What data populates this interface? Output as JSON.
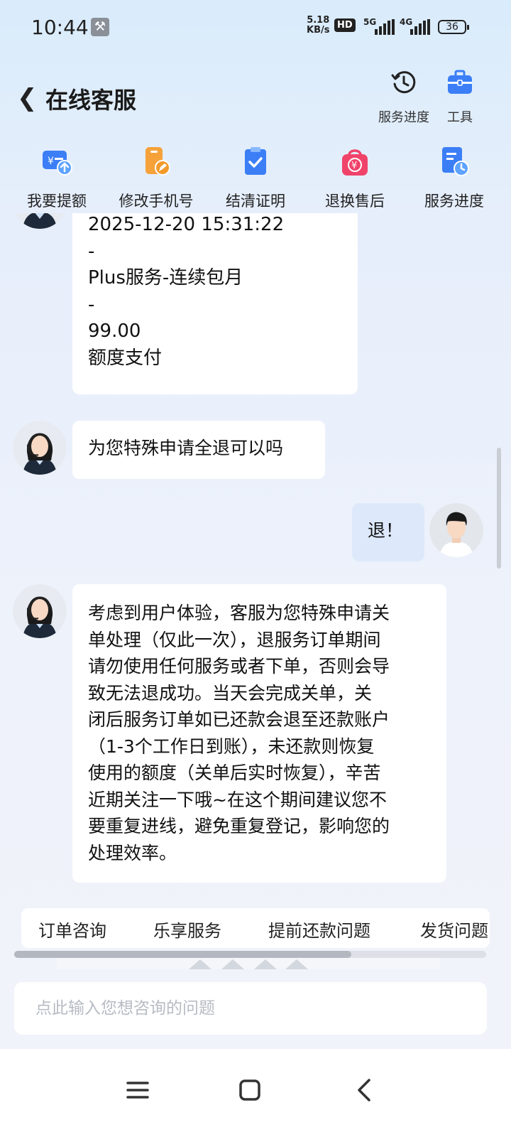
{
  "status_bar": {
    "time": "10:44",
    "net_speed_value": "5.18",
    "net_speed_unit": "KB/s",
    "hd_badge": "HD",
    "signal_1": "5G",
    "signal_2": "4G",
    "battery": "36"
  },
  "header": {
    "back_icon": "chevron-left-icon",
    "title": "在线客服",
    "tools": [
      {
        "label": "服务进度",
        "icon": "clock-history-icon"
      },
      {
        "label": "工具",
        "icon": "toolbox-icon"
      }
    ]
  },
  "quick_actions": [
    {
      "label": "我要提额",
      "icon": "wallet-up-icon"
    },
    {
      "label": "修改手机号",
      "icon": "phone-edit-icon"
    },
    {
      "label": "结清证明",
      "icon": "clipboard-check-icon"
    },
    {
      "label": "退换售后",
      "icon": "refund-bag-icon"
    },
    {
      "label": "服务进度",
      "icon": "document-clock-icon"
    }
  ],
  "messages": {
    "order_card": {
      "line1": "2025-12-20 15:31:22",
      "line2": "-",
      "line3": "Plus服务-连续包月",
      "line4": "-",
      "line5": "99.00",
      "line6": "额度支付"
    },
    "agent_1": "为您特殊申请全退可以吗",
    "user_1": "退！",
    "agent_2": {
      "lines": [
        "考虑到用户体验，客服为您特殊申请关",
        "单处理（仅此一次），退服务订单期间",
        "请勿使用任何服务或者下单，否则会导",
        "致无法退成功。当天会完成关单，关",
        "闭后服务订单如已还款会退至还款账户",
        "（1-3个工作日到账），未还款则恢复",
        "使用的额度（关单后实时恢复），辛苦",
        "近期关注一下哦~在这个期间建议您不",
        "要重复进线，避免重复登记，影响您的",
        "处理效率。"
      ]
    }
  },
  "quick_topics": [
    "订单咨询",
    "乐享服务",
    "提前还款问题",
    "发货问题"
  ],
  "input": {
    "placeholder": "点此输入您想咨询的问题"
  },
  "nav_bar": {
    "menu_icon": "menu-icon",
    "home_icon": "home-square-icon",
    "back_icon": "back-triangle-icon"
  },
  "colors": {
    "accent_blue": "#3b7ef6",
    "orange": "#f39a2a",
    "pink": "#f0436a",
    "user_bubble": "#dde9fb"
  }
}
